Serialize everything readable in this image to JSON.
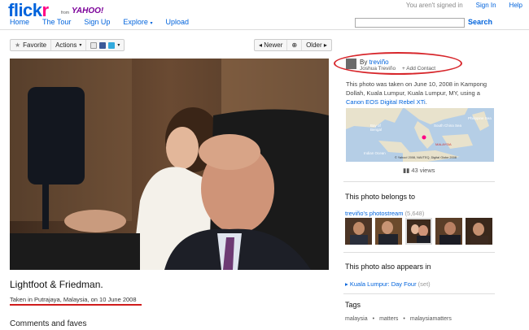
{
  "header": {
    "logo_part1": "flick",
    "logo_part2": "r",
    "from_label": "from",
    "yahoo": "YAHOO!",
    "nav": [
      "Home",
      "The Tour",
      "Sign Up",
      "Explore",
      "Upload"
    ],
    "not_signed_in": "You aren't signed in",
    "sign_in": "Sign In",
    "help": "Help",
    "search_button": "Search"
  },
  "toolbar": {
    "favorite": "Favorite",
    "actions": "Actions",
    "newer": "Newer",
    "older": "Older",
    "favorite_icon": "star-icon",
    "caret_icon": "chevron-down-icon",
    "share_icons": [
      "email-icon",
      "facebook-icon",
      "twitter-icon"
    ],
    "zoom_icon": "zoom-icon"
  },
  "photo": {
    "title": "Lightfoot & Friedman.",
    "taken": "Taken in Putrajaya, Malaysia, on 10 June 2008",
    "comments_heading": "Comments and faves"
  },
  "owner": {
    "by": "By",
    "username": "treviño",
    "realname": "Joshua Treviño",
    "add_contact": "+ Add Contact",
    "desc_text": "This photo was taken on June 10, 2008 in Kampong Dollah, Kuala Lumpur, Kuala Lumpur, MY, using a",
    "camera": "Canon EOS Digital Rebel XTi",
    "map_labels": {
      "bay": "Bay of Bengal",
      "scs": "South China Sea",
      "phil": "Philippine Sea",
      "indian": "Indian Ocean",
      "malaysia": "MALAYSIA",
      "copyright": "© Yahoo! 2008, NAVTEQ, Digital Globe 2008"
    },
    "views": "43 views"
  },
  "belongs": {
    "heading": "This photo belongs to",
    "stream": "treviño's photostream",
    "count": "(5,648)"
  },
  "appears": {
    "heading": "This photo also appears in",
    "set": "Kuala Lumpur: Day Four",
    "set_suffix": "(set)"
  },
  "tags": {
    "heading": "Tags",
    "items": [
      "malaysia",
      "matters",
      "malaysiamatters"
    ]
  },
  "colors": {
    "flickr_blue": "#0063dc",
    "flickr_pink": "#ff0084",
    "annotation_red": "#d7262b"
  }
}
